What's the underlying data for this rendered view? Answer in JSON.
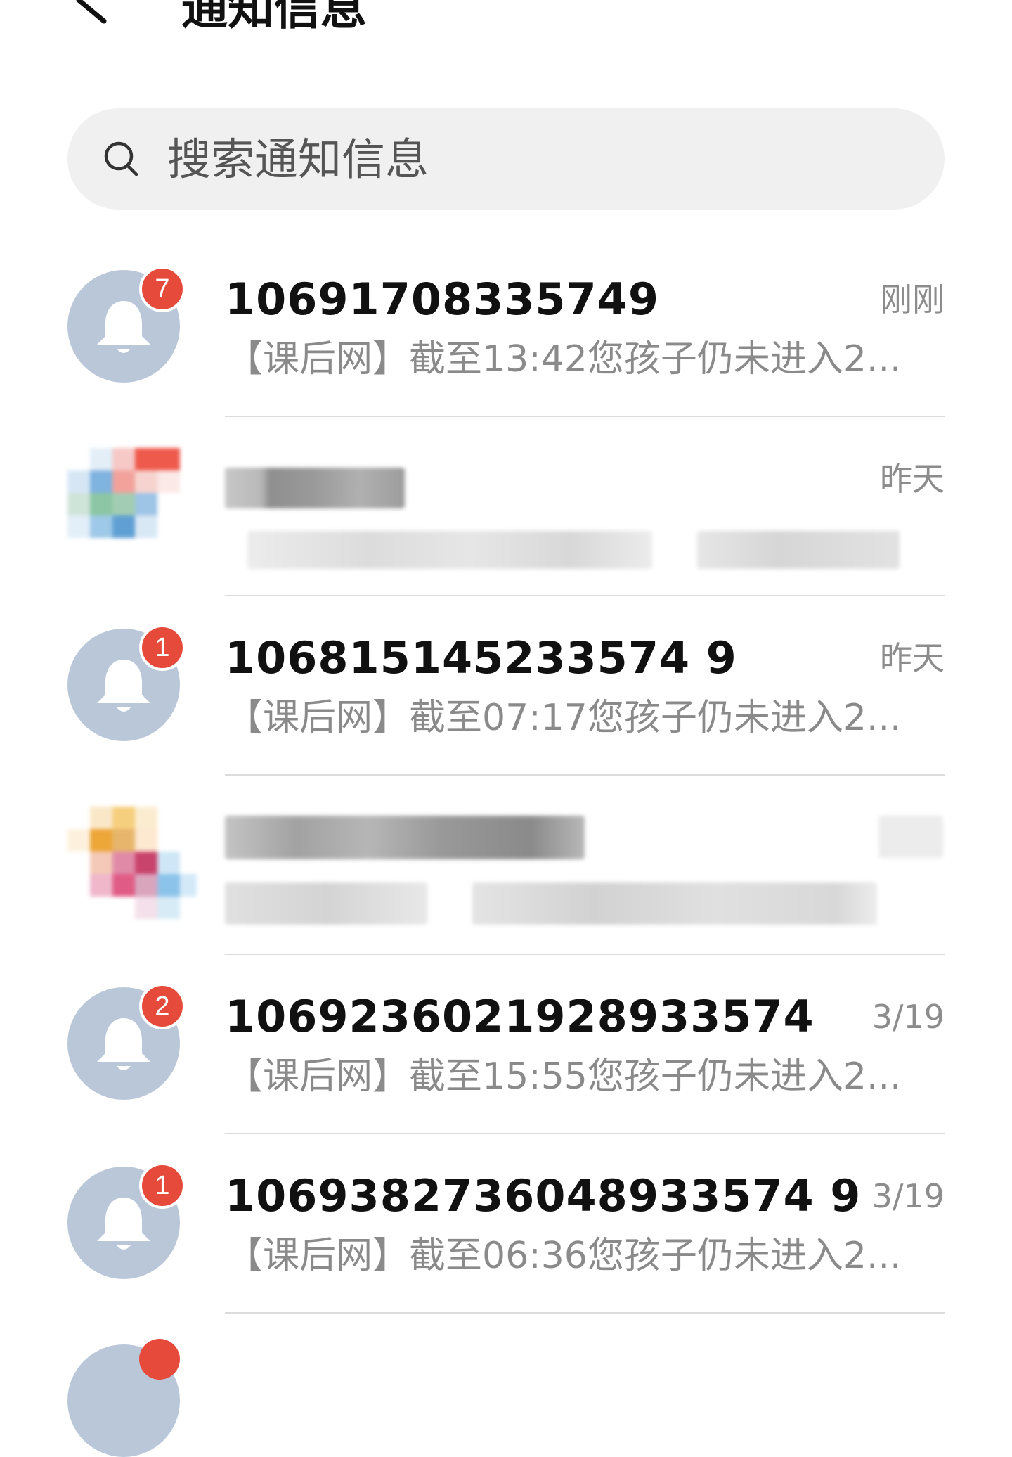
{
  "header": {
    "title": "通知信息"
  },
  "search": {
    "placeholder": "搜索通知信息"
  },
  "conversations": [
    {
      "sender": "10691708335749",
      "time": "刚刚",
      "preview": "【课后网】截至13:42您孩子仍未进入2...",
      "unread": "7",
      "blurred": false
    },
    {
      "sender": "",
      "time": "昨天",
      "preview": "",
      "unread": "",
      "blurred": true
    },
    {
      "sender": "106815145233574 9",
      "time": "昨天",
      "preview": "【课后网】截至07:17您孩子仍未进入2...",
      "unread": "1",
      "blurred": false
    },
    {
      "sender": "",
      "time": "",
      "preview": "",
      "unread": "",
      "blurred": true
    },
    {
      "sender": "1069236021928933574",
      "time": "3/19",
      "preview": "【课后网】截至15:55您孩子仍未进入2...",
      "unread": "2",
      "blurred": false
    },
    {
      "sender": "1069382736048933574 9",
      "time": "3/19",
      "preview": "【课后网】截至06:36您孩子仍未进入2...",
      "unread": "1",
      "blurred": false
    }
  ],
  "colors": {
    "badge": "#e64a3b",
    "avatar": "#b9c7d8",
    "search_bg": "#f0f0f0",
    "divider": "#dcdcdc"
  }
}
